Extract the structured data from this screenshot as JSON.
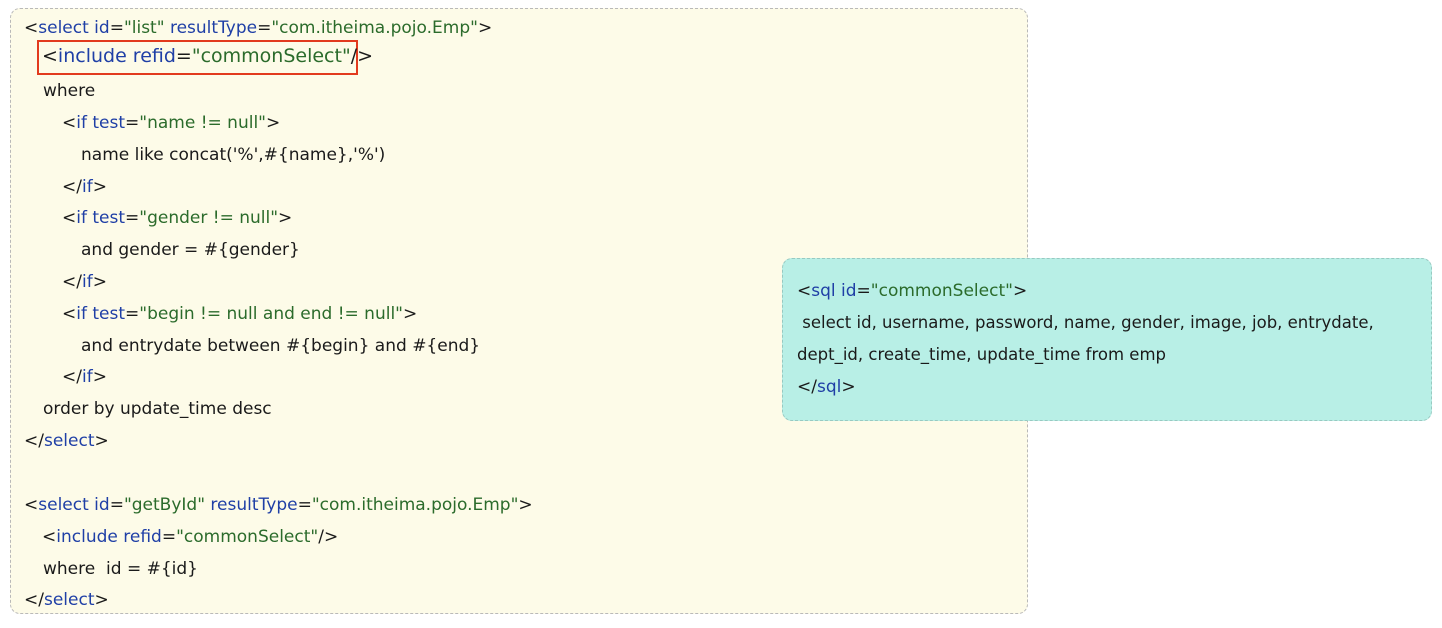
{
  "colors": {
    "panel_main_bg": "#fdfbe8",
    "panel_sql_bg": "#b8efe6",
    "highlight_border": "#e23a1e",
    "tag": "#1f3fa6",
    "value": "#2b6b2b",
    "text": "#1a1a1a"
  },
  "select_list": {
    "l1": {
      "lt": "<",
      "tag": "select",
      "a1": " id",
      "e1": "=",
      "v1": "\"list\"",
      "a2": " resultType",
      "e2": "=",
      "v2": "\"com.itheima.pojo.Emp\"",
      "gt": ">"
    },
    "l2": {
      "lt": "<",
      "tag": "include",
      "a1": " refid",
      "e1": "=",
      "v1": "\"commonSelect\"",
      "gt": "/>"
    },
    "l3": "where",
    "l4": {
      "lt": "<",
      "tag": "if",
      "a1": " test",
      "e1": "=",
      "v1": "\"name != null\"",
      "gt": ">"
    },
    "l5": "name like concat('%',#{name},'%')",
    "l6": {
      "lt": "</",
      "tag": "if",
      "gt": ">"
    },
    "l7": {
      "lt": "<",
      "tag": "if",
      "a1": " test",
      "e1": "=",
      "v1": "\"gender != null\"",
      "gt": ">"
    },
    "l8": "and gender = #{gender}",
    "l9": {
      "lt": "</",
      "tag": "if",
      "gt": ">"
    },
    "l10": {
      "lt": "<",
      "tag": "if",
      "a1": " test",
      "e1": "=",
      "v1": "\"begin != null and end != null\"",
      "gt": ">"
    },
    "l11": "and entrydate between #{begin} and #{end}",
    "l12": {
      "lt": "</",
      "tag": "if",
      "gt": ">"
    },
    "l13": "order by update_time desc",
    "l14": {
      "lt": "</",
      "tag": "select",
      "gt": ">"
    }
  },
  "select_getbyid": {
    "l1": {
      "lt": "<",
      "tag": "select",
      "a1": " id",
      "e1": "=",
      "v1": "\"getById\"",
      "a2": " resultType",
      "e2": "=",
      "v2": "\"com.itheima.pojo.Emp\"",
      "gt": ">"
    },
    "l2": {
      "lt": "<",
      "tag": "include",
      "a1": " refid",
      "e1": "=",
      "v1": "\"commonSelect\"",
      "gt": "/>"
    },
    "l3": "where  id = #{id}",
    "l4": {
      "lt": "</",
      "tag": "select",
      "gt": ">"
    }
  },
  "sql_fragment": {
    "l1": {
      "lt": "<",
      "tag": "sql",
      "a1": " id",
      "e1": "=",
      "v1": "\"commonSelect\"",
      "gt": ">"
    },
    "l2": " select id, username, password, name, gender, image, job, entrydate,",
    "l3": "dept_id, create_time, update_time from emp",
    "l4": {
      "lt": "</",
      "tag": "sql",
      "gt": ">"
    }
  }
}
